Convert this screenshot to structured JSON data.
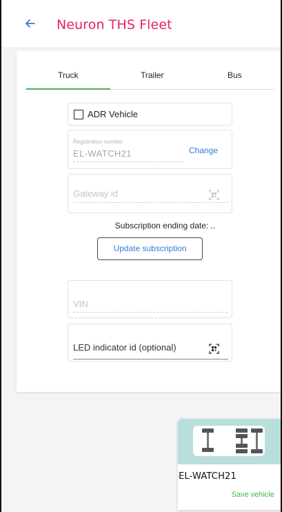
{
  "header": {
    "title": "Neuron THS Fleet",
    "back_icon": "arrow-left-icon",
    "title_color": "#e8245a",
    "accent_color": "#2f7fd8"
  },
  "tabs": [
    {
      "label": "Truck",
      "active": true
    },
    {
      "label": "Trailer",
      "active": false
    },
    {
      "label": "Bus",
      "active": false
    }
  ],
  "tab_indicator_color": "#4caf50",
  "form": {
    "adr_label": "ADR Vehicle",
    "adr_checked": false,
    "registration": {
      "label": "Registration number",
      "value": "EL-WATCH21",
      "change_label": "Change"
    },
    "gateway": {
      "placeholder": "Gateway id",
      "icon": "qr-scan-icon"
    },
    "subscription_text": "Subscription ending date: ..",
    "update_button_label": "Update subscription",
    "vin": {
      "placeholder": "VIN"
    },
    "led": {
      "label": "LED indicator id (optional)",
      "icon": "qr-scan-icon"
    }
  },
  "vehicle_card": {
    "name": "EL-WATCH21",
    "save_label": "Save vehicle",
    "icon": "truck-axle-diagram-icon",
    "save_color": "#3db843",
    "background_color": "#b8dfdb"
  }
}
